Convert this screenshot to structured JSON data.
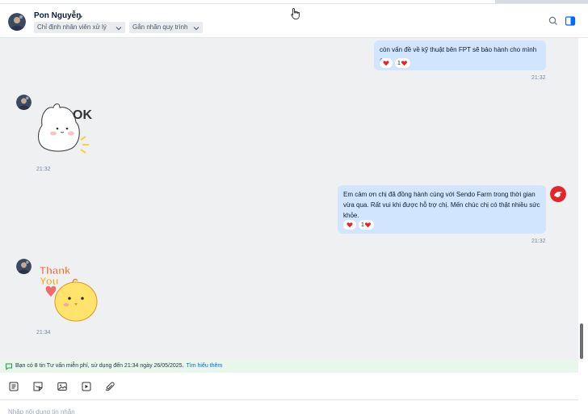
{
  "header": {
    "contact_name": "Pon Nguyễn",
    "assign_chip": "Chỉ định nhân viên xử lý",
    "label_chip": "Gắn nhãn quy trình"
  },
  "messages": [
    {
      "direction": "out",
      "text": "còn vấn đề về kỹ thuật bên FPT sẽ bảo hành cho mình ạ.",
      "reaction_count": "1",
      "time": "21:32"
    },
    {
      "direction": "in",
      "type": "sticker",
      "sticker_text": "OK",
      "time": "21:32"
    },
    {
      "direction": "out",
      "text": "Em cảm ơn chị đã đồng hành cùng với Sendo Farm trong thời gian vừa qua. Rất vui khi được hỗ trợ chị. Mến chúc chị có thật nhiều sức khỏe.",
      "reaction_count": "1",
      "time": "21:32"
    },
    {
      "direction": "in",
      "type": "sticker",
      "sticker_text": [
        "Thank",
        "You"
      ],
      "time": "21:34"
    }
  ],
  "notice": {
    "text": "Bạn có 8 tin Tư vấn miễn phí, sử dụng đến 21:34 ngày 26/05/2025.",
    "link": "Tìm hiểu thêm"
  },
  "toolbar": {
    "icons": [
      "quick-message-icon",
      "sticker-icon",
      "image-icon",
      "video-icon",
      "attachment-icon"
    ]
  },
  "composer": {
    "placeholder": "Nhập nội dung tin nhắn"
  },
  "colors": {
    "outgoing_bubble": "#d2e5fe",
    "chat_background": "#eef0f1",
    "notice_background": "#e9f6ec",
    "link": "#0068ff",
    "reaction_heart": "#e5252a"
  }
}
